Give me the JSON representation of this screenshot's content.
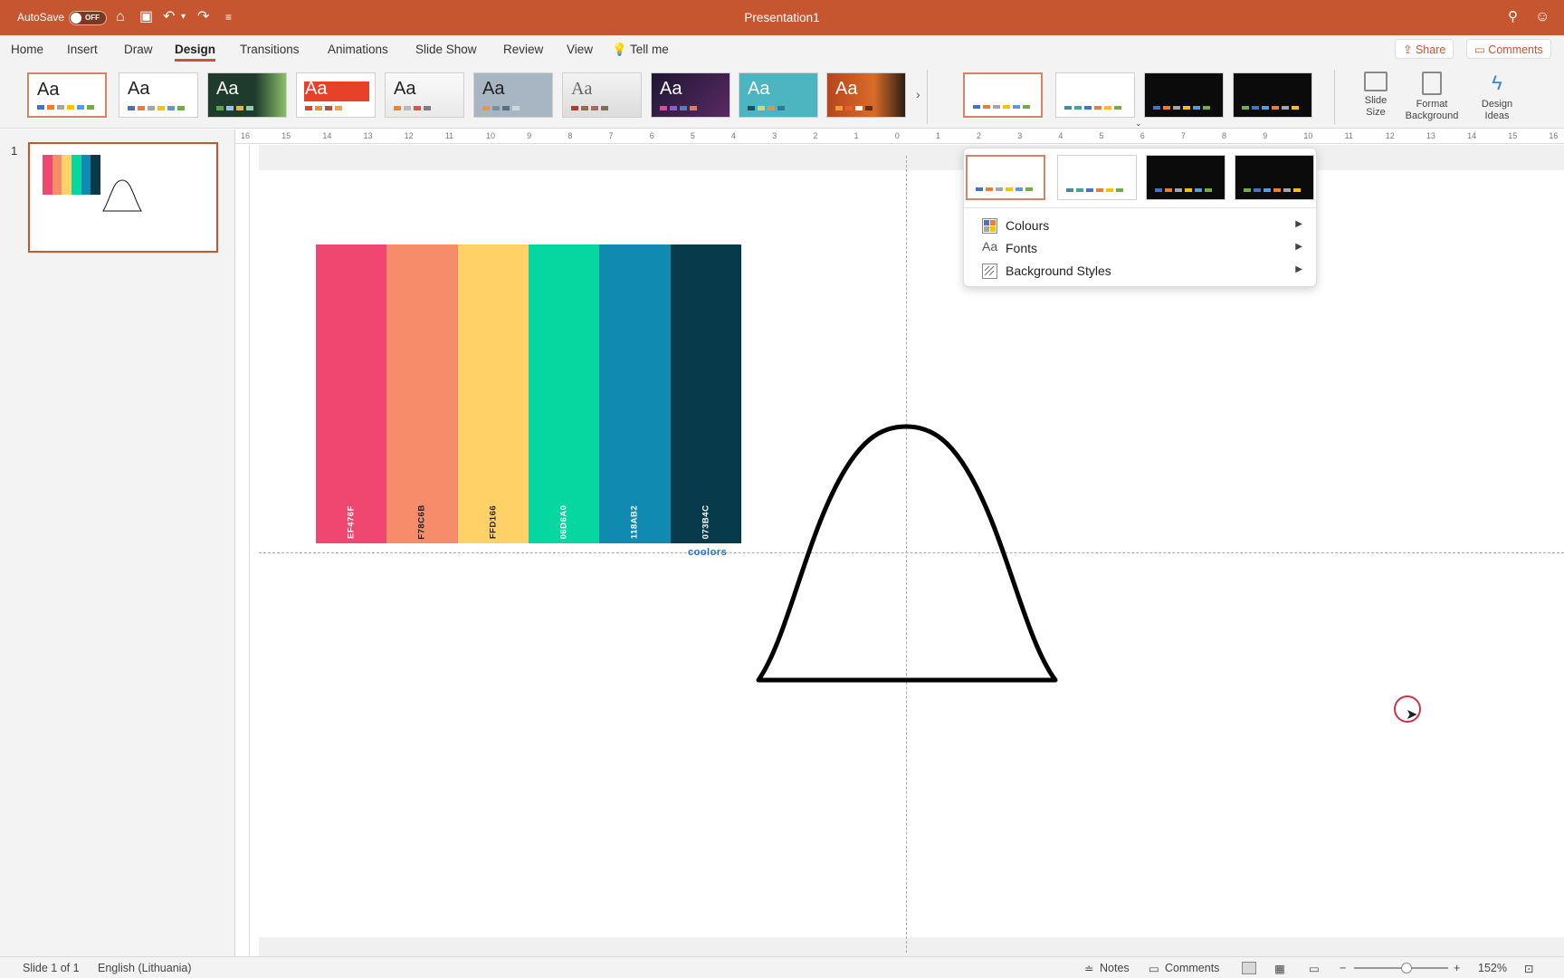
{
  "titlebar": {
    "autosave_label": "AutoSave",
    "toggle_state": "OFF",
    "document_title": "Presentation1",
    "icons": [
      "home-icon",
      "save-icon",
      "undo-icon",
      "redo-icon",
      "customize-icon",
      "search-icon",
      "smiley-icon"
    ]
  },
  "tabs": [
    {
      "label": "Home"
    },
    {
      "label": "Insert"
    },
    {
      "label": "Draw"
    },
    {
      "label": "Design",
      "active": true
    },
    {
      "label": "Transitions"
    },
    {
      "label": "Animations"
    },
    {
      "label": "Slide Show"
    },
    {
      "label": "Review"
    },
    {
      "label": "View"
    }
  ],
  "tell_me": "Tell me",
  "share_label": "Share",
  "comments_label": "Comments",
  "ribbon": {
    "themes_aa": "Aa",
    "slide_size": "Slide Size",
    "format_background": "Format Background",
    "design_ideas": "Design Ideas"
  },
  "ruler": {
    "h_ticks": [
      "16",
      "15",
      "14",
      "13",
      "12",
      "11",
      "10",
      "9",
      "8",
      "7",
      "6",
      "5",
      "4",
      "3",
      "2",
      "1",
      "0",
      "1",
      "2",
      "3",
      "4",
      "5",
      "6",
      "7",
      "8",
      "9",
      "10",
      "11",
      "12",
      "13",
      "14",
      "15",
      "16"
    ]
  },
  "slides_panel": {
    "slide_number": "1"
  },
  "palette": {
    "colors": [
      {
        "hex": "#EF476F",
        "label": "EF476F",
        "text_color": "#ffffff"
      },
      {
        "hex": "#F78C6B",
        "label": "F78C6B",
        "text_color": "#222222"
      },
      {
        "hex": "#FFD166",
        "label": "FFD166",
        "text_color": "#222222"
      },
      {
        "hex": "#06D6A0",
        "label": "06D6A0",
        "text_color": "#ffffff"
      },
      {
        "hex": "#118AB2",
        "label": "118AB2",
        "text_color": "#ffffff"
      },
      {
        "hex": "#073B4C",
        "label": "073B4C",
        "text_color": "#ffffff"
      }
    ],
    "brand": "coolors"
  },
  "dropdown": {
    "items": [
      {
        "label": "Colours",
        "icon": "colours-icon"
      },
      {
        "label": "Fonts",
        "icon": "fonts-icon"
      },
      {
        "label": "Background Styles",
        "icon": "background-styles-icon"
      }
    ]
  },
  "statusbar": {
    "slide_info": "Slide 1 of 1",
    "language": "English (Lithuania)",
    "notes": "Notes",
    "comments": "Comments",
    "zoom": "152%"
  }
}
